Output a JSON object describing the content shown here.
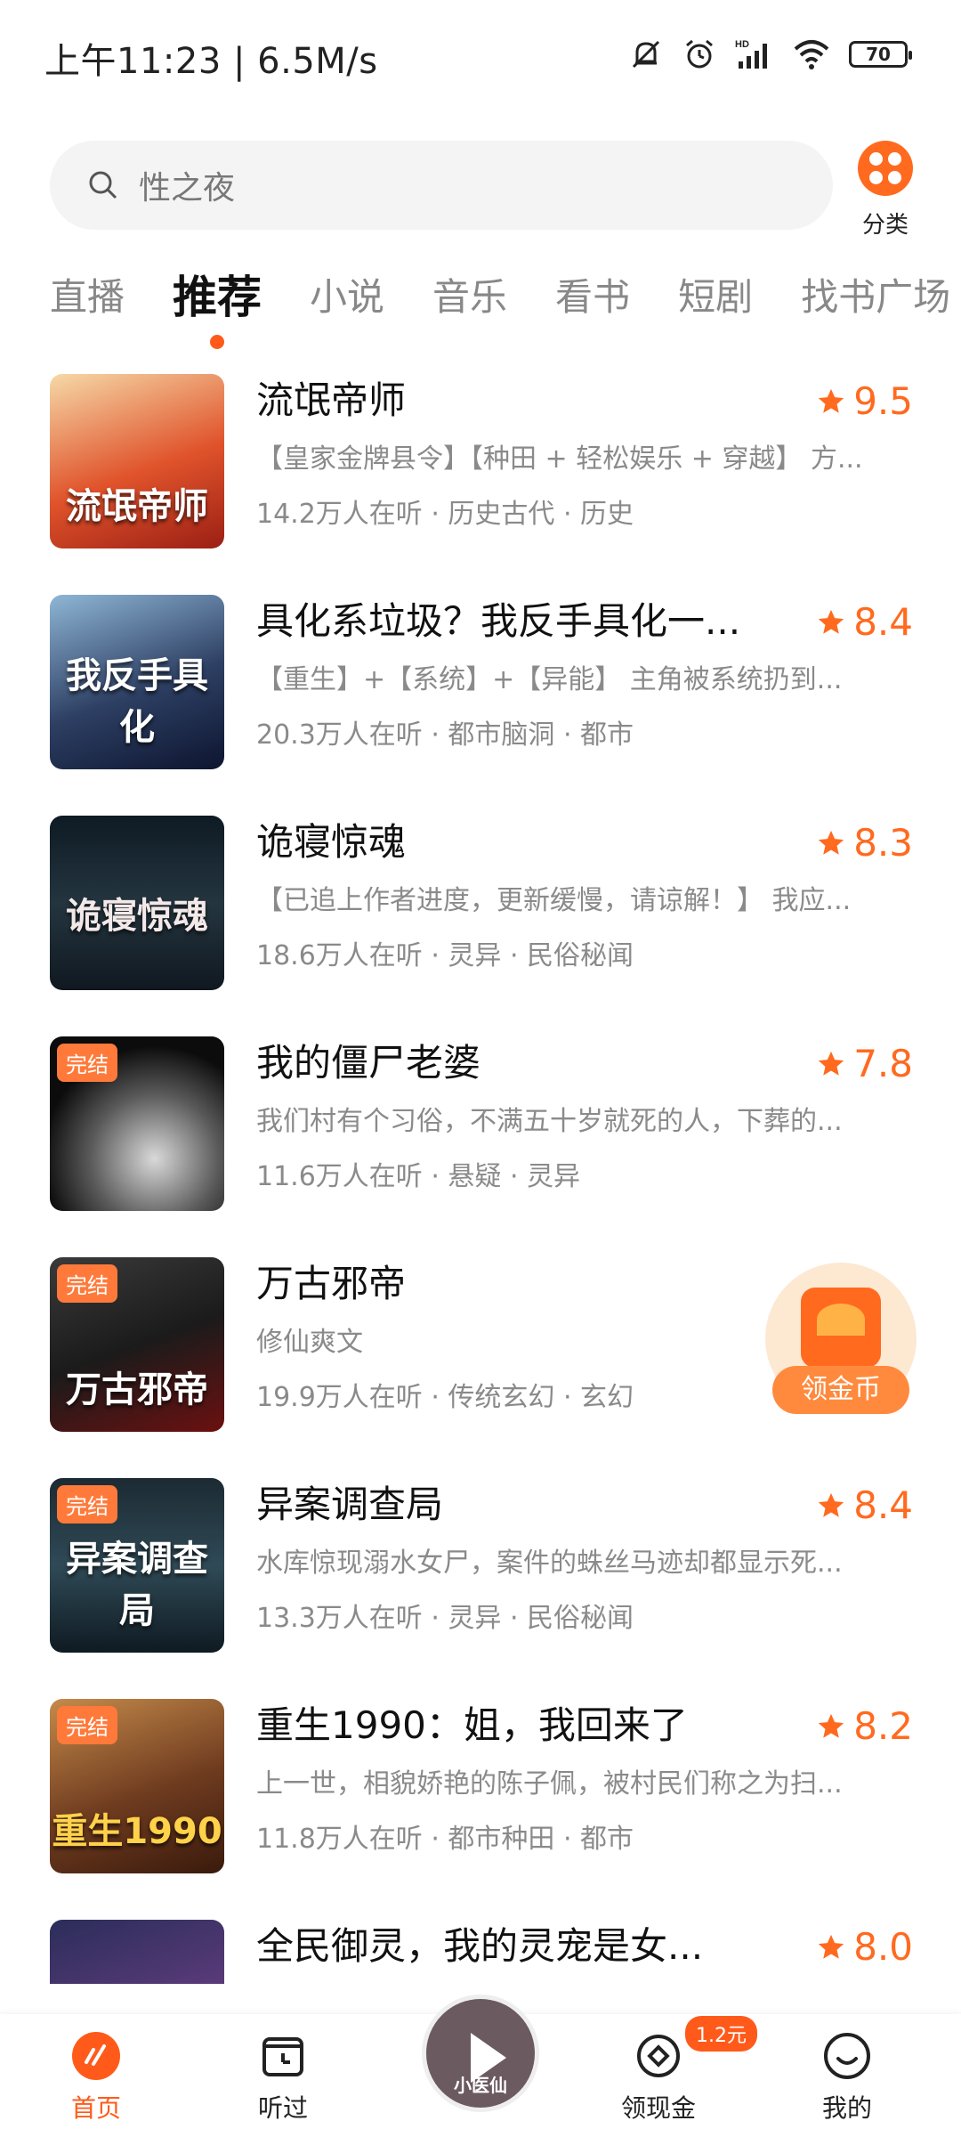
{
  "status": {
    "time_speed": "上午11:23 | 6.5M/s",
    "battery": "70"
  },
  "search": {
    "placeholder": "性之夜",
    "category_label": "分类"
  },
  "tabs": [
    "直播",
    "推荐",
    "小说",
    "音乐",
    "看书",
    "短剧",
    "找书广场"
  ],
  "active_tab": "推荐",
  "books": [
    {
      "title": "流氓帝师",
      "desc": "【皇家金牌县令】【种田 + 轻松娱乐 + 穿越】 方...",
      "meta": "14.2万人在听 · 历史古代 · 历史",
      "rating": "9.5",
      "badge": "",
      "cover_text": "流氓帝师"
    },
    {
      "title": "具化系垃圾？我反手具化一...",
      "desc": "【重生】+【系统】+【异能】 主角被系统扔到...",
      "meta": "20.3万人在听 · 都市脑洞 · 都市",
      "rating": "8.4",
      "badge": "",
      "cover_text": "我反手具化"
    },
    {
      "title": "诡寝惊魂",
      "desc": "【已追上作者进度，更新缓慢，请谅解！】 我应...",
      "meta": "18.6万人在听 · 灵异 · 民俗秘闻",
      "rating": "8.3",
      "badge": "",
      "cover_text": "诡寝惊魂"
    },
    {
      "title": "我的僵尸老婆",
      "desc": "我们村有个习俗，不满五十岁就死的人，下葬的...",
      "meta": "11.6万人在听 · 悬疑 · 灵异",
      "rating": "7.8",
      "badge": "完结",
      "cover_text": ""
    },
    {
      "title": "万古邪帝",
      "desc": "修仙爽文",
      "meta": "19.9万人在听 · 传统玄幻 · 玄幻",
      "rating": "",
      "badge": "完结",
      "cover_text": "万古邪帝"
    },
    {
      "title": "异案调查局",
      "desc": "水库惊现溺水女尸，案件的蛛丝马迹却都显示死...",
      "meta": "13.3万人在听 · 灵异 · 民俗秘闻",
      "rating": "8.4",
      "badge": "完结",
      "cover_text": "异案调查局"
    },
    {
      "title": "重生1990：姐，我回来了",
      "desc": "上一世，相貌娇艳的陈子佩，被村民们称之为扫...",
      "meta": "11.8万人在听 · 都市种田 · 都市",
      "rating": "8.2",
      "badge": "完结",
      "cover_text": "重生1990"
    },
    {
      "title": "全民御灵，我的灵宠是女...",
      "desc": "",
      "meta": "",
      "rating": "8.0",
      "badge": "",
      "cover_text": ""
    }
  ],
  "coin_float": {
    "label": "领金币"
  },
  "nav": {
    "home": "首页",
    "history": "听过",
    "cash": "领现金",
    "cash_badge": "1.2元",
    "me": "我的",
    "player_cover_text": "小医仙"
  },
  "colors": {
    "accent": "#ff5a1a",
    "rating": "#ff6a1f",
    "muted_text": "#8a8a8a"
  }
}
